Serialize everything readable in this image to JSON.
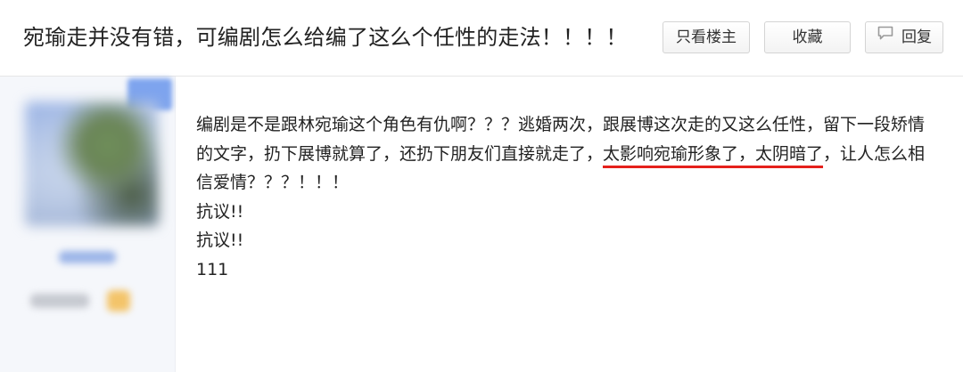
{
  "header": {
    "title": "宛瑜走并没有错，可编剧怎么给编了这么个任性的走法！！！！",
    "buttons": {
      "only_op": "只看楼主",
      "favorite": "收藏",
      "reply": "回复"
    },
    "reply_icon": "speech-bubble-icon"
  },
  "post": {
    "paragraph": {
      "part1": "编剧是不是跟林宛瑜这个角色有仇啊？？？逃婚两次，跟展博这次走的又这么任性，留下一段矫情的文字，扔下展博就算了，还扔下朋友们直接就走了，",
      "highlight": "太影响宛瑜形象了，太阴暗了",
      "part2": "，让人怎么相信爱情？？？！！！"
    },
    "lines": [
      "抗议!!",
      "抗议!!",
      "111"
    ],
    "highlight_color": "#e5201b"
  }
}
